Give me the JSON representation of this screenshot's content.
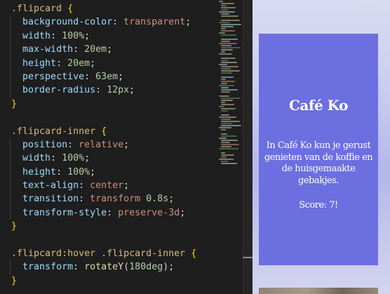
{
  "editor": {
    "code": {
      "lines": [
        [
          {
            "t": ".flipcard",
            "c": "t-sel"
          },
          {
            "t": " "
          },
          {
            "t": "{",
            "c": "t-brace"
          }
        ],
        [
          {
            "t": "  "
          },
          {
            "t": "background-color",
            "c": "t-prop"
          },
          {
            "t": ": "
          },
          {
            "t": "transparent",
            "c": "t-val"
          },
          {
            "t": ";"
          }
        ],
        [
          {
            "t": "  "
          },
          {
            "t": "width",
            "c": "t-prop"
          },
          {
            "t": ": "
          },
          {
            "t": "100%",
            "c": "t-num"
          },
          {
            "t": ";"
          }
        ],
        [
          {
            "t": "  "
          },
          {
            "t": "max-width",
            "c": "t-prop"
          },
          {
            "t": ": "
          },
          {
            "t": "20em",
            "c": "t-num"
          },
          {
            "t": ";"
          }
        ],
        [
          {
            "t": "  "
          },
          {
            "t": "height",
            "c": "t-prop"
          },
          {
            "t": ": "
          },
          {
            "t": "20em",
            "c": "t-num"
          },
          {
            "t": ";"
          }
        ],
        [
          {
            "t": "  "
          },
          {
            "t": "perspective",
            "c": "t-prop"
          },
          {
            "t": ": "
          },
          {
            "t": "63em",
            "c": "t-num"
          },
          {
            "t": ";"
          }
        ],
        [
          {
            "t": "  "
          },
          {
            "t": "border-radius",
            "c": "t-prop"
          },
          {
            "t": ": "
          },
          {
            "t": "12px",
            "c": "t-num"
          },
          {
            "t": ";"
          }
        ],
        [
          {
            "t": "}",
            "c": "t-brace"
          }
        ],
        [],
        [
          {
            "t": ".flipcard-inner",
            "c": "t-sel"
          },
          {
            "t": " "
          },
          {
            "t": "{",
            "c": "t-brace"
          }
        ],
        [
          {
            "t": "  "
          },
          {
            "t": "position",
            "c": "t-prop"
          },
          {
            "t": ": "
          },
          {
            "t": "relative",
            "c": "t-val"
          },
          {
            "t": ";"
          }
        ],
        [
          {
            "t": "  "
          },
          {
            "t": "width",
            "c": "t-prop"
          },
          {
            "t": ": "
          },
          {
            "t": "100%",
            "c": "t-num"
          },
          {
            "t": ";"
          }
        ],
        [
          {
            "t": "  "
          },
          {
            "t": "height",
            "c": "t-prop"
          },
          {
            "t": ": "
          },
          {
            "t": "100%",
            "c": "t-num"
          },
          {
            "t": ";"
          }
        ],
        [
          {
            "t": "  "
          },
          {
            "t": "text-align",
            "c": "t-prop"
          },
          {
            "t": ": "
          },
          {
            "t": "center",
            "c": "t-val"
          },
          {
            "t": ";"
          }
        ],
        [
          {
            "t": "  "
          },
          {
            "t": "transition",
            "c": "t-prop"
          },
          {
            "t": ": "
          },
          {
            "t": "transform ",
            "c": "t-val"
          },
          {
            "t": "0.8s",
            "c": "t-num"
          },
          {
            "t": ";"
          }
        ],
        [
          {
            "t": "  "
          },
          {
            "t": "transform-style",
            "c": "t-prop"
          },
          {
            "t": ": "
          },
          {
            "t": "preserve-3d",
            "c": "t-val"
          },
          {
            "t": ";"
          }
        ],
        [
          {
            "t": "}",
            "c": "t-brace"
          }
        ],
        [],
        [
          {
            "t": ".flipcard:hover .flipcard-inner",
            "c": "t-sel"
          },
          {
            "t": " "
          },
          {
            "t": "{",
            "c": "t-brace"
          }
        ],
        [
          {
            "t": "  "
          },
          {
            "t": "transform",
            "c": "t-prop"
          },
          {
            "t": ": "
          },
          {
            "t": "rotateY",
            "c": "t-fn"
          },
          {
            "t": "("
          },
          {
            "t": "180deg",
            "c": "t-num"
          },
          {
            "t": ");"
          }
        ],
        [
          {
            "t": "}",
            "c": "t-brace"
          }
        ]
      ]
    }
  },
  "preview": {
    "card": {
      "title": "Café Ko",
      "description": "In Café Ko kun je gerust genieten van de koffie en de huisgemaakte gebakjes.",
      "score": "Score: 7!"
    }
  },
  "colors": {
    "editor_bg": "#1e1e1e",
    "selector": "#d7ba7d",
    "property": "#9cdcfe",
    "string_value": "#ce9178",
    "number": "#b5cea8",
    "brace": "#ffd700",
    "card_bg": "#6b6fe0"
  }
}
